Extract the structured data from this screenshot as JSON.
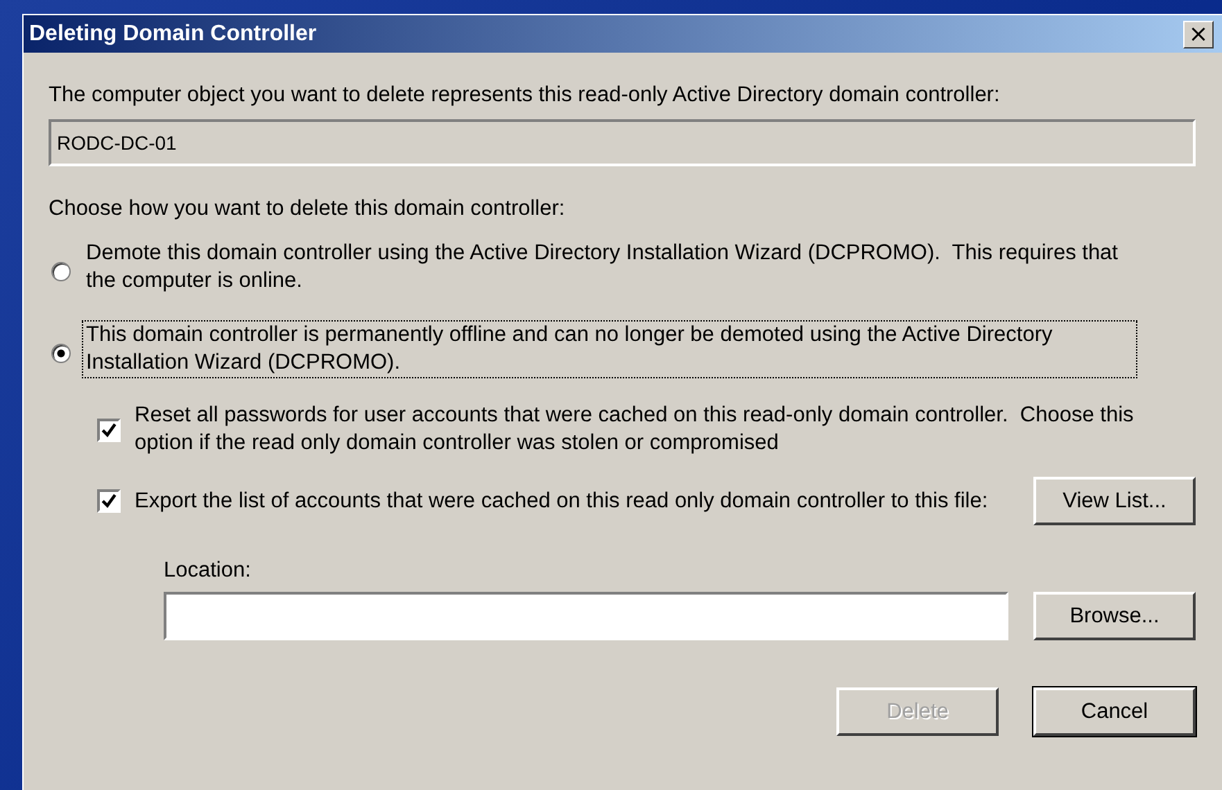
{
  "window": {
    "title": "Deleting Domain Controller",
    "close": "×"
  },
  "object_label": "The computer object you want to delete represents this read-only Active Directory domain controller:",
  "object_field": {
    "value": "RODC-DC-01"
  },
  "choice_label": "Choose how you want to delete this domain controller:",
  "options": [
    {
      "label": "Demote this domain controller using the Active Directory Installation Wizard (DCPROMO).  This requires that the computer is online.",
      "selected": false,
      "focused": false
    },
    {
      "label": "This domain controller is permanently offline and can no longer be demoted using the Active Directory Installation Wizard (DCPROMO).",
      "selected": true,
      "focused": true
    }
  ],
  "checkboxes": [
    {
      "label": "Reset all passwords for user accounts that were cached on this read-only domain controller.  Choose this option if the read only domain controller was stolen or compromised",
      "checked": true
    },
    {
      "label": "Export the list of accounts that were cached on this read only domain controller to this file:",
      "checked": true,
      "button": "View List..."
    }
  ],
  "location": {
    "label": "Location:",
    "button": "Browse..."
  },
  "buttons": [
    {
      "label": "Delete",
      "disabled": true
    },
    {
      "label": "Cancel",
      "disabled": false
    }
  ]
}
